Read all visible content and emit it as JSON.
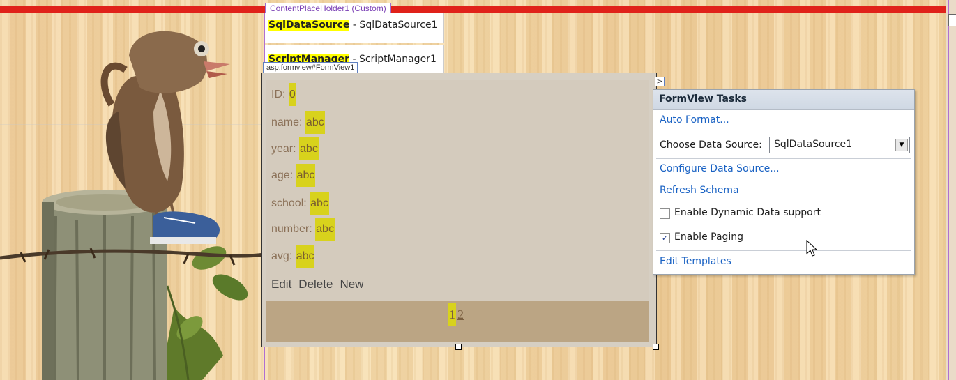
{
  "content_placeholder": {
    "label": "ContentPlaceHolder1 (Custom)"
  },
  "components": [
    {
      "type": "SqlDataSource",
      "name": " - SqlDataSource1"
    },
    {
      "type": "ScriptManager",
      "name": " - ScriptManager1"
    }
  ],
  "formview": {
    "tag": "asp:formview#FormView1",
    "fields": [
      {
        "label": "ID: ",
        "value": "0"
      },
      {
        "label": "name: ",
        "value": "abc"
      },
      {
        "label": "year: ",
        "value": "abc"
      },
      {
        "label": "age: ",
        "value": "abc"
      },
      {
        "label": "school: ",
        "value": "abc"
      },
      {
        "label": "number: ",
        "value": "abc"
      },
      {
        "label": "avg: ",
        "value": "abc"
      }
    ],
    "links": {
      "edit": "Edit",
      "delete": "Delete",
      "new": "New"
    },
    "pager": {
      "current": "1",
      "other": "2"
    }
  },
  "smart_tag_glyph": ">",
  "tasks_panel": {
    "title": "FormView Tasks",
    "auto_format": "Auto Format...",
    "choose_ds_label": "Choose Data Source:",
    "choose_ds_value": "SqlDataSource1",
    "configure": "Configure Data Source...",
    "refresh": "Refresh Schema",
    "dynamic_data": {
      "label": "Enable Dynamic Data support",
      "checked": false
    },
    "paging": {
      "label": "Enable Paging",
      "checked": true
    },
    "edit_templates": "Edit Templates"
  },
  "colors": {
    "top_bar": "#e0221a",
    "highlight": "#ffff00",
    "field_highlight": "#d8d21c",
    "link_blue": "#1b63c4",
    "placeholder_border": "#9f6fd0"
  },
  "icons": {
    "check_glyph": "✓",
    "dropdown_glyph": "▼",
    "cursor": "mouse-pointer-icon"
  }
}
